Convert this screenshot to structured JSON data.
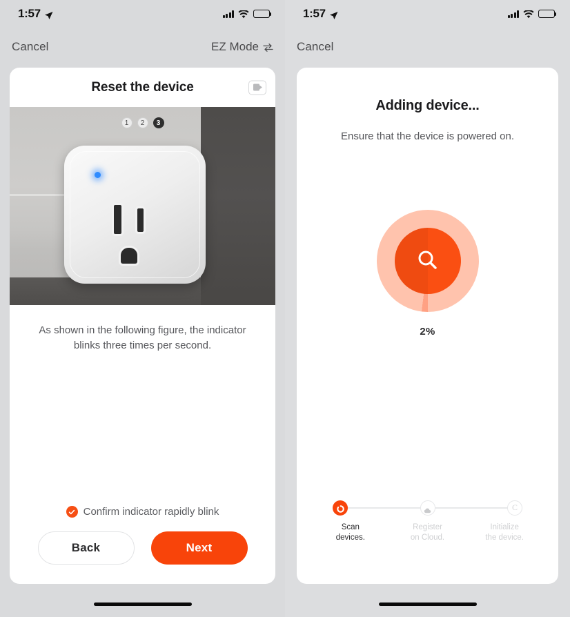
{
  "left": {
    "status": {
      "time": "1:57",
      "location_icon": "location-arrow-icon",
      "signal_icon": "cellular-bars-icon",
      "wifi_icon": "wifi-icon",
      "battery_icon": "battery-icon"
    },
    "nav": {
      "cancel_label": "Cancel",
      "mode_label": "EZ Mode",
      "mode_icon": "swap-arrows-icon"
    },
    "card": {
      "title": "Reset the device",
      "video_icon": "video-camera-icon",
      "photo": {
        "alt": "smart-plug-photo",
        "steps": [
          {
            "number": "1",
            "state": "inactive"
          },
          {
            "number": "2",
            "state": "inactive"
          },
          {
            "number": "3",
            "state": "active"
          }
        ]
      },
      "caption": "As shown in the following figure, the indicator blinks three times per second.",
      "confirm": {
        "icon": "check-circle-icon",
        "label": "Confirm indicator rapidly blink",
        "checked": true
      },
      "buttons": {
        "back_label": "Back",
        "next_label": "Next"
      }
    }
  },
  "right": {
    "status": {
      "time": "1:57",
      "location_icon": "location-arrow-icon",
      "signal_icon": "cellular-bars-icon",
      "wifi_icon": "wifi-icon",
      "battery_icon": "battery-icon"
    },
    "nav": {
      "cancel_label": "Cancel"
    },
    "card": {
      "title": "Adding device...",
      "subtitle": "Ensure that the device is powered on.",
      "progress": {
        "percent_label": "2%",
        "percent_value": 2,
        "icon": "magnifier-icon"
      },
      "steps": [
        {
          "label_line1": "Scan",
          "label_line2": "devices.",
          "icon": "spinner-icon",
          "state": "active"
        },
        {
          "label_line1": "Register",
          "label_line2": "on Cloud.",
          "icon": "cloud-icon",
          "state": "idle"
        },
        {
          "label_line1": "Initialize",
          "label_line2": "the device.",
          "icon": "c-circle-icon",
          "state": "idle"
        }
      ]
    }
  },
  "colors": {
    "accent_orange": "#F8440A",
    "progress_core": "#FA4F12",
    "progress_ring": "#FFC3AD",
    "background": "#D9DADC",
    "card": "#FFFFFF",
    "text_primary": "#1B1B1D",
    "text_secondary": "#55565A",
    "text_muted": "#CFD0D2"
  }
}
